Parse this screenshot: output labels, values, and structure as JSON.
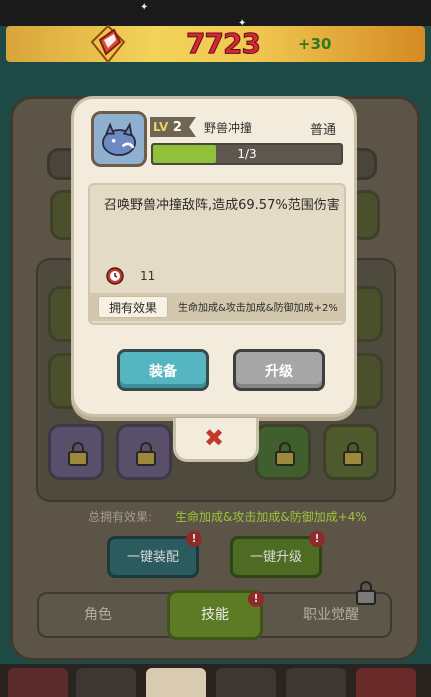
{
  "hud": {
    "gem_icon": "crystal-icon",
    "amount": "7723",
    "gain": "+30"
  },
  "popup": {
    "level_prefix": "LV",
    "level": "2",
    "skill_name": "野兽冲撞",
    "rarity": "普通",
    "progress_text": "1/3",
    "progress_fraction": 0.333,
    "description": "召唤野兽冲撞敌阵,造成69.57%范围伤害",
    "cooldown_value": "11",
    "effect_label": "拥有效果",
    "effect_text": "生命加成&攻击加成&防御加成+2%",
    "equip_button": "装备",
    "upgrade_button": "升级",
    "close_icon": "close-x-icon"
  },
  "background": {
    "total_effect_label": "总拥有效果:",
    "total_effect_text": "生命加成&攻击加成&防御加成+4%",
    "equip_all_button": "一键装配",
    "upgrade_all_button": "一键升级",
    "badge": "!",
    "tabs": [
      "角色",
      "技能",
      "职业觉醒"
    ],
    "active_tab": "技能"
  },
  "colors": {
    "accent_gold": "#f3d35a",
    "amount_red": "#d6263a",
    "gain_green": "#2f7a1f",
    "equip_teal": "#55b6c2",
    "upgrade_gray": "#a6a6a6",
    "progress_green": "#8fc13a"
  }
}
